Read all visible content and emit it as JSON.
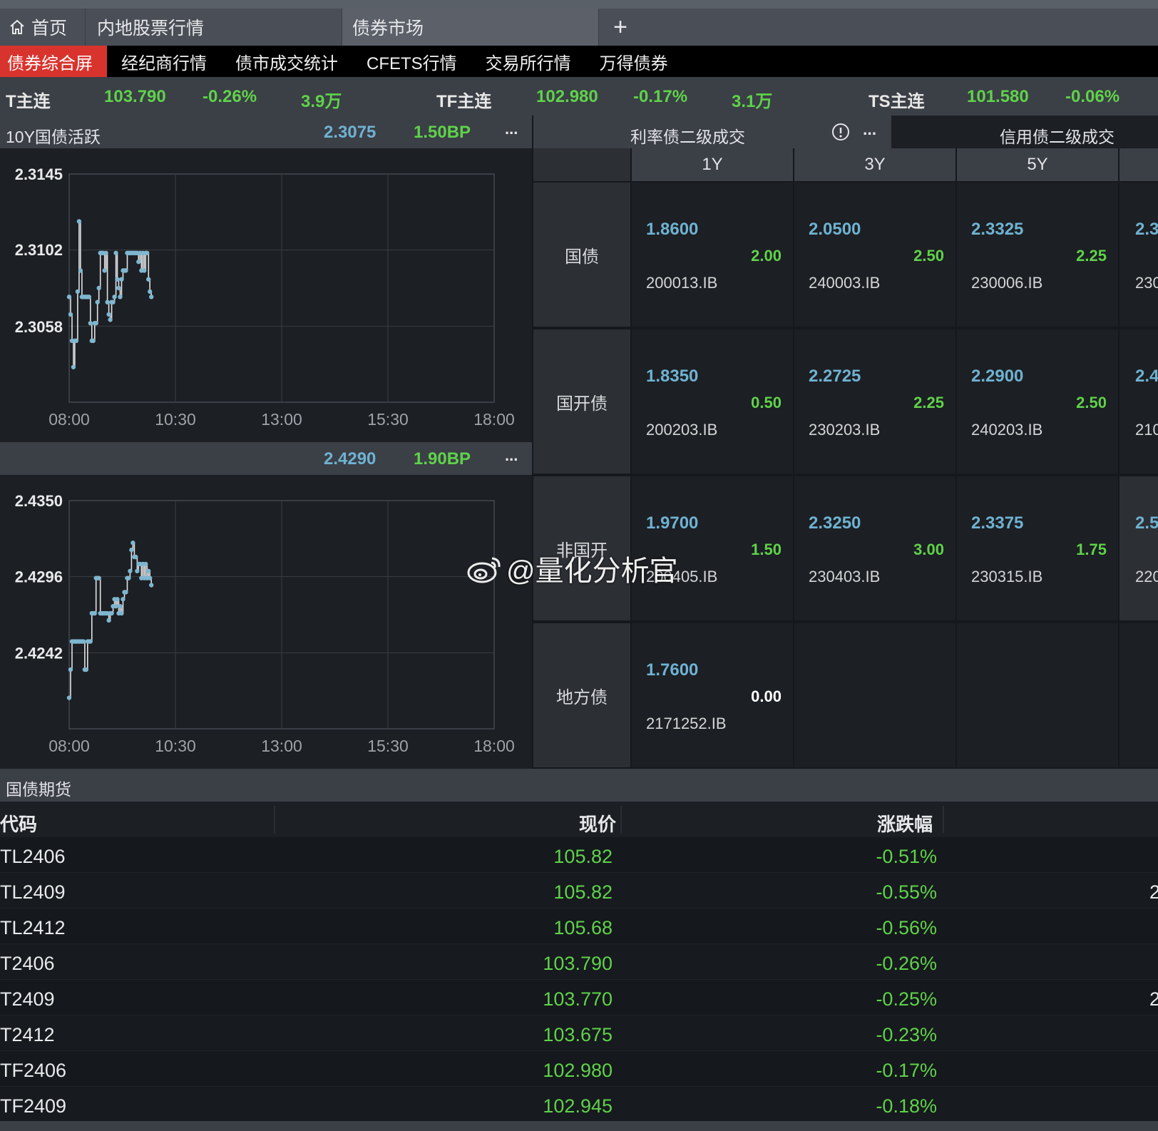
{
  "tabs": {
    "home": "首页",
    "stock": "内地股票行情",
    "bond": "债券市场",
    "add": "+"
  },
  "subnav": [
    "债券综合屏",
    "经纪商行情",
    "债市成交统计",
    "CFETS行情",
    "交易所行情",
    "万得债券"
  ],
  "ticker": [
    {
      "name": "T主连",
      "price": "103.790",
      "chg": "-0.26%",
      "vol": "3.9万"
    },
    {
      "name": "TF主连",
      "price": "102.980",
      "chg": "-0.17%",
      "vol": "3.1万"
    },
    {
      "name": "TS主连",
      "price": "101.580",
      "chg": "-0.06%"
    }
  ],
  "panel1": {
    "title": "10Y国债活跃",
    "yield": "2.3075",
    "bp": "1.50BP",
    "more": "...",
    "y_ticks": [
      "2.3145",
      "2.3102",
      "2.3058"
    ],
    "x_ticks": [
      "08:00",
      "10:30",
      "13:00",
      "15:30",
      "18:00"
    ]
  },
  "panel2": {
    "title": "",
    "yield": "2.4290",
    "bp": "1.90BP",
    "more": "...",
    "y_ticks": [
      "2.4350",
      "2.4296",
      "2.4242"
    ],
    "x_ticks": [
      "08:00",
      "10:30",
      "13:00",
      "15:30",
      "18:00"
    ]
  },
  "chart_data": [
    {
      "type": "line",
      "title": "10Y国债活跃",
      "xlabel": "",
      "ylabel": "",
      "x_range": [
        "08:00",
        "18:00"
      ],
      "ylim": [
        2.3015,
        2.3145
      ],
      "grid": true,
      "x_minutes": [
        0,
        2,
        4,
        6,
        8,
        10,
        12,
        14,
        16,
        18,
        20,
        22,
        24,
        26,
        28,
        30,
        32,
        34,
        36,
        38,
        40,
        42,
        44,
        46,
        48,
        50,
        52,
        54,
        56,
        58,
        60,
        62,
        64,
        66,
        68,
        70,
        72,
        74,
        76,
        78,
        80,
        82,
        84,
        86,
        88,
        90,
        92,
        94,
        96,
        98,
        100,
        102,
        104,
        106,
        108,
        110,
        112,
        114,
        116
      ],
      "values": [
        2.3075,
        2.3065,
        2.305,
        2.3035,
        2.305,
        2.305,
        2.3078,
        2.3118,
        2.309,
        2.3075,
        2.3075,
        2.3075,
        2.3075,
        2.3075,
        2.3075,
        2.306,
        2.305,
        2.305,
        2.306,
        2.306,
        2.3072,
        2.308,
        2.31,
        2.31,
        2.31,
        2.309,
        2.31,
        2.3072,
        2.3065,
        2.3062,
        2.3072,
        2.3072,
        2.3075,
        2.31,
        2.3085,
        2.308,
        2.3075,
        2.3085,
        2.309,
        2.309,
        2.309,
        2.31,
        2.31,
        2.31,
        2.31,
        2.31,
        2.31,
        2.31,
        2.31,
        2.3095,
        2.31,
        2.309,
        2.31,
        2.309,
        2.31,
        2.31,
        2.3085,
        2.3078,
        2.3075
      ]
    },
    {
      "type": "line",
      "title": "",
      "xlabel": "",
      "ylabel": "",
      "x_range": [
        "08:00",
        "18:00"
      ],
      "ylim": [
        2.4188,
        2.435
      ],
      "grid": true,
      "x_minutes": [
        0,
        2,
        4,
        6,
        8,
        10,
        12,
        14,
        16,
        18,
        20,
        22,
        24,
        26,
        28,
        30,
        32,
        34,
        36,
        38,
        40,
        42,
        44,
        46,
        48,
        50,
        52,
        54,
        56,
        58,
        60,
        62,
        64,
        66,
        68,
        70,
        72,
        74,
        76,
        78,
        80,
        82,
        84,
        86,
        88,
        90,
        92,
        94,
        96,
        98,
        100,
        102,
        104,
        106,
        108,
        110,
        112,
        114,
        116
      ],
      "values": [
        2.421,
        2.423,
        2.425,
        2.425,
        2.425,
        2.425,
        2.425,
        2.425,
        2.425,
        2.425,
        2.425,
        2.423,
        2.423,
        2.425,
        2.425,
        2.425,
        2.427,
        2.427,
        2.427,
        2.4295,
        2.4295,
        2.4295,
        2.427,
        2.427,
        2.427,
        2.427,
        2.427,
        2.427,
        2.4265,
        2.427,
        2.427,
        2.4275,
        2.428,
        2.4275,
        2.428,
        2.427,
        2.4275,
        2.427,
        2.428,
        2.4285,
        2.4285,
        2.4295,
        2.4295,
        2.43,
        2.4315,
        2.432,
        2.431,
        2.431,
        2.43,
        2.4305,
        2.4305,
        2.4295,
        2.4305,
        2.4295,
        2.4305,
        2.4295,
        2.43,
        2.4295,
        2.429
      ]
    }
  ],
  "matrix": {
    "header_rate": "利率债二级成交",
    "header_rate_more": "...",
    "header_credit": "信用债二级成交",
    "cols": [
      "1Y",
      "3Y",
      "5Y"
    ],
    "rows": [
      {
        "name": "国债",
        "cells": [
          {
            "yield": "1.8600",
            "bp": "2.00",
            "code": "200013.IB"
          },
          {
            "yield": "2.0500",
            "bp": "2.50",
            "code": "240003.IB"
          },
          {
            "yield": "2.3325",
            "bp": "2.25",
            "code": "230006.IB"
          }
        ],
        "clip": {
          "yield": "2.3",
          "code": "230"
        }
      },
      {
        "name": "国开债",
        "cells": [
          {
            "yield": "1.8350",
            "bp": "0.50",
            "code": "200203.IB"
          },
          {
            "yield": "2.2725",
            "bp": "2.25",
            "code": "230203.IB"
          },
          {
            "yield": "2.2900",
            "bp": "2.50",
            "code": "240203.IB"
          }
        ],
        "clip": {
          "yield": "2.4",
          "code": "210"
        }
      },
      {
        "name": "非国开",
        "cells": [
          {
            "yield": "1.9700",
            "bp": "1.50",
            "code": "200405.IB"
          },
          {
            "yield": "2.3250",
            "bp": "3.00",
            "code": "230403.IB"
          },
          {
            "yield": "2.3375",
            "bp": "1.75",
            "code": "230315.IB"
          }
        ],
        "clip": {
          "yield": "2.5",
          "code": "220"
        }
      },
      {
        "name": "地方债",
        "cells": [
          {
            "yield": "1.7600",
            "bp": "0.00",
            "code": "2171252.IB"
          }
        ]
      }
    ]
  },
  "futures": {
    "title": "国债期货",
    "headers": {
      "code": "代码",
      "price": "现价",
      "chg": "涨跌幅"
    },
    "rows": [
      {
        "code": "TL2406",
        "price": "105.82",
        "chg": "-0.51%",
        "extra": ""
      },
      {
        "code": "TL2409",
        "price": "105.82",
        "chg": "-0.55%",
        "extra": "2"
      },
      {
        "code": "TL2412",
        "price": "105.68",
        "chg": "-0.56%",
        "extra": ""
      },
      {
        "code": "T2406",
        "price": "103.790",
        "chg": "-0.26%",
        "extra": ""
      },
      {
        "code": "T2409",
        "price": "103.770",
        "chg": "-0.25%",
        "extra": "2"
      },
      {
        "code": "T2412",
        "price": "103.675",
        "chg": "-0.23%",
        "extra": ""
      },
      {
        "code": "TF2406",
        "price": "102.980",
        "chg": "-0.17%",
        "extra": ""
      },
      {
        "code": "TF2409",
        "price": "102.945",
        "chg": "-0.18%",
        "extra": ""
      }
    ]
  },
  "watermark": "@量化分析官",
  "colors": {
    "accent_red": "#d9332d",
    "up_green": "#5fd24a",
    "yield_teal": "#6fb2d2",
    "line_blue": "#7fb6cf"
  }
}
